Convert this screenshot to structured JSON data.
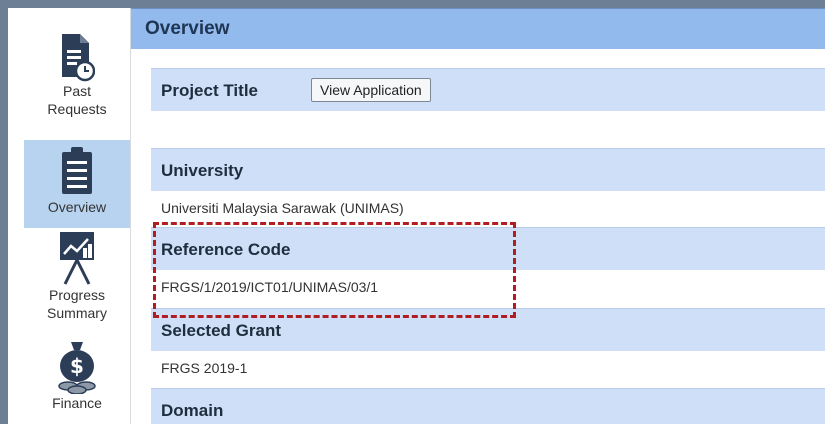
{
  "sidebar": {
    "items": [
      {
        "label_line1": "Past",
        "label_line2": "Requests",
        "icon": "document-clock-icon"
      },
      {
        "label_line1": "Overview",
        "label_line2": "",
        "icon": "clipboard-icon"
      },
      {
        "label_line1": "Progress",
        "label_line2": "Summary",
        "icon": "chart-board-icon"
      },
      {
        "label_line1": "Finance",
        "label_line2": "",
        "icon": "money-bag-icon"
      }
    ],
    "active_index": 1
  },
  "header": {
    "title": "Overview"
  },
  "sections": {
    "project_title": {
      "label": "Project Title",
      "button": "View Application",
      "value": ""
    },
    "university": {
      "label": "University",
      "value": "Universiti Malaysia Sarawak (UNIMAS)"
    },
    "reference_code": {
      "label": "Reference Code",
      "value": "FRGS/1/2019/ICT01/UNIMAS/03/1"
    },
    "selected_grant": {
      "label": "Selected Grant",
      "value": "FRGS 2019-1"
    },
    "domain": {
      "label": "Domain"
    }
  },
  "colors": {
    "header_bg": "#93baed",
    "label_bg": "#cfdff8",
    "active_sidebar_bg": "#b7d3ef",
    "highlight": "#b01d22"
  }
}
